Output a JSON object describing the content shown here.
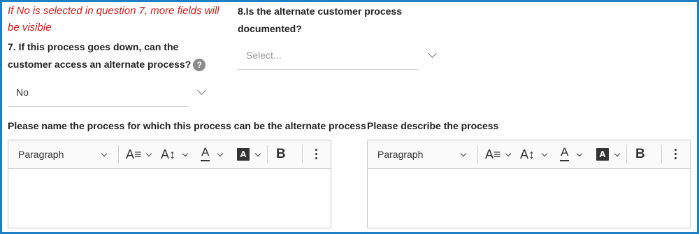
{
  "note": "If No is selected in question 7, more fields will be visible",
  "q7": {
    "label": "7. If this process goes down, can the customer access an alternate process?",
    "help_icon_text": "?",
    "value": "No"
  },
  "q8": {
    "label": "8.Is the alternate customer process documented?",
    "placeholder": "Select..."
  },
  "field_left": {
    "label": "Please name the process for which this process can be the alternate process"
  },
  "field_right": {
    "label": "Please describe the process"
  },
  "toolbar": {
    "paragraph_label": "Paragraph",
    "bold_label": "B",
    "font_color_glyph": "A",
    "highlight_glyph": "A"
  },
  "colors": {
    "frame": "#1e7fc4",
    "note": "#d41b1b"
  }
}
